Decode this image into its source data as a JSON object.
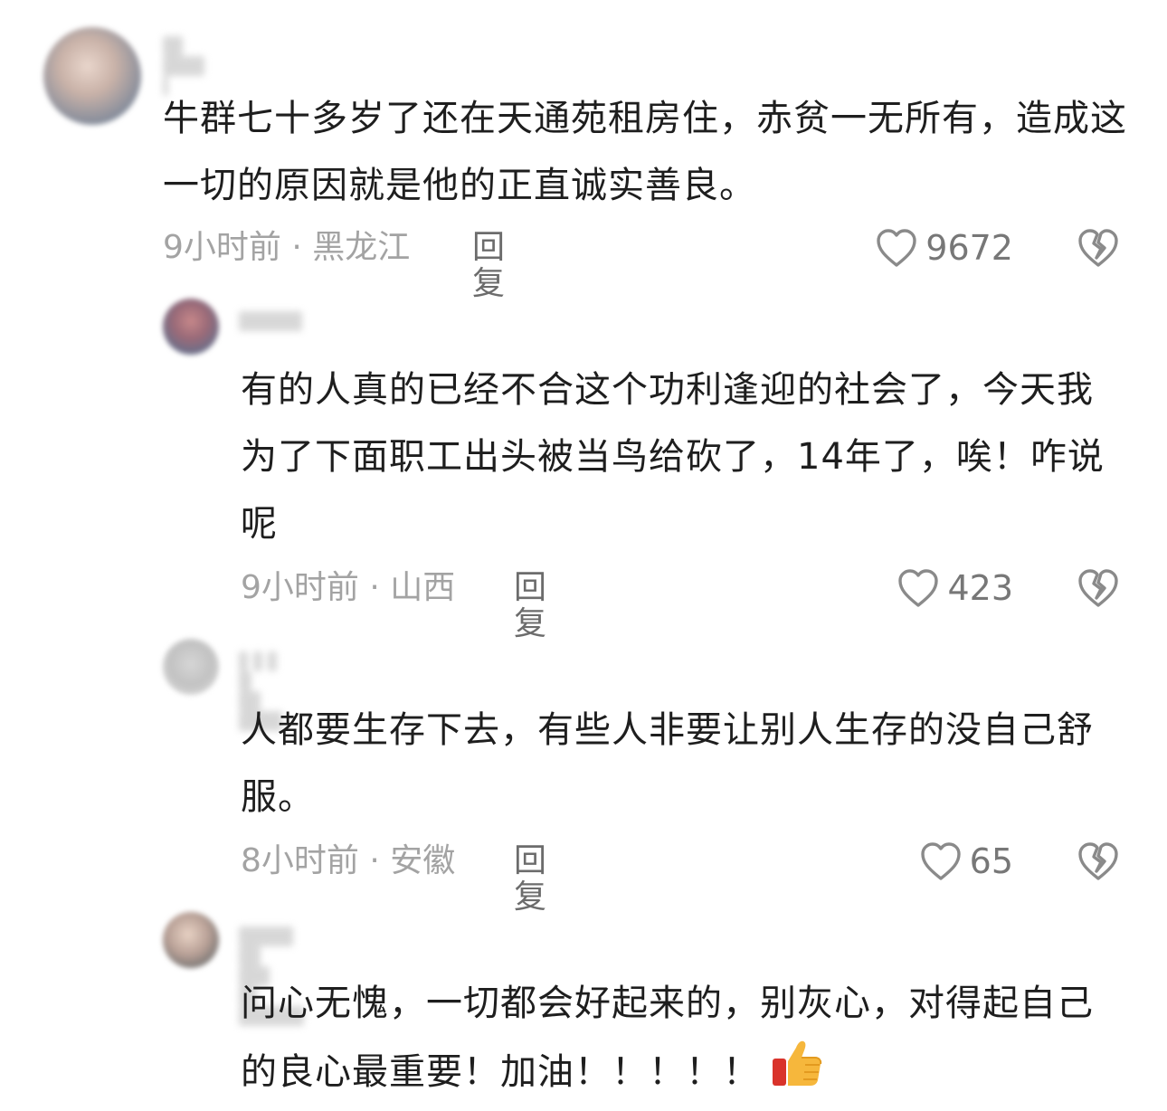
{
  "comments": [
    {
      "text": "牛群七十多岁了还在天通苑租房住，赤贫一无所有，造成这一切的原因就是他的正直诚实善良。",
      "meta": "9小时前 · 黑龙江",
      "reply_label": "回复",
      "likes": "9672"
    },
    {
      "text": "有的人真的已经不合这个功利逢迎的社会了，今天我为了下面职工出头被当鸟给砍了，14年了，唉！咋说呢",
      "meta": "9小时前 · 山西",
      "reply_label": "回复",
      "likes": "423"
    },
    {
      "text": "人都要生存下去，有些人非要让别人生存的没自己舒服。",
      "meta": "8小时前 · 安徽",
      "reply_label": "回复",
      "likes": "65"
    },
    {
      "text": "问心无愧，一切都会好起来的，别灰心，对得起自己的良心最重要！加油！！！！！",
      "emoji": "thumbs-up-icon"
    }
  ],
  "colors": {
    "text": "#1e1e1e",
    "meta": "#a3a3a3",
    "reply": "#6c6c6c",
    "icon": "#8a8a8a"
  }
}
